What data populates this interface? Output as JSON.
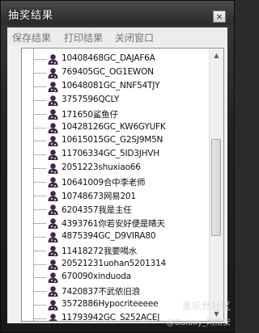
{
  "window": {
    "title": "抽奖结果",
    "close_glyph": "×"
  },
  "menu": {
    "items": [
      "保存结果",
      "打印结果",
      "关闭窗口"
    ]
  },
  "list": {
    "items": [
      "10408468GC_DAJAF6A",
      "769405GC_OG1EWON",
      "10648081GC_NNF54TJY",
      "3757596QCLY",
      "171650鲨鱼仔",
      "10428126GC_KW6GYUFK",
      "10615015GC_G2SJ9M5N",
      "11706334GC_5ID3JHVH",
      "2051223shuxiao66",
      "10641009合中李老师",
      "10748673网易201",
      "6204357我是主任",
      "4393761你若安好便是晴天",
      "4875394GC_D9VIRA80",
      "11418272我要喝水",
      "20521231uohan5201314",
      "670090xinduoda",
      "7420837不武依旧浪",
      "3572886Hypocriteeeee",
      "11793942GC_S252ACEJ"
    ]
  },
  "scrollbar": {
    "up_glyph": "▲",
    "down_glyph": "▼"
  },
  "watermark": {
    "line1": "盖乐世社区",
    "line2": "@Galaxy_网络安"
  },
  "colors": {
    "title_bg": "#2a2a2a",
    "menu_text": "#777777",
    "icon_body": "#3b2a52",
    "icon_accent": "#e8c26a"
  }
}
